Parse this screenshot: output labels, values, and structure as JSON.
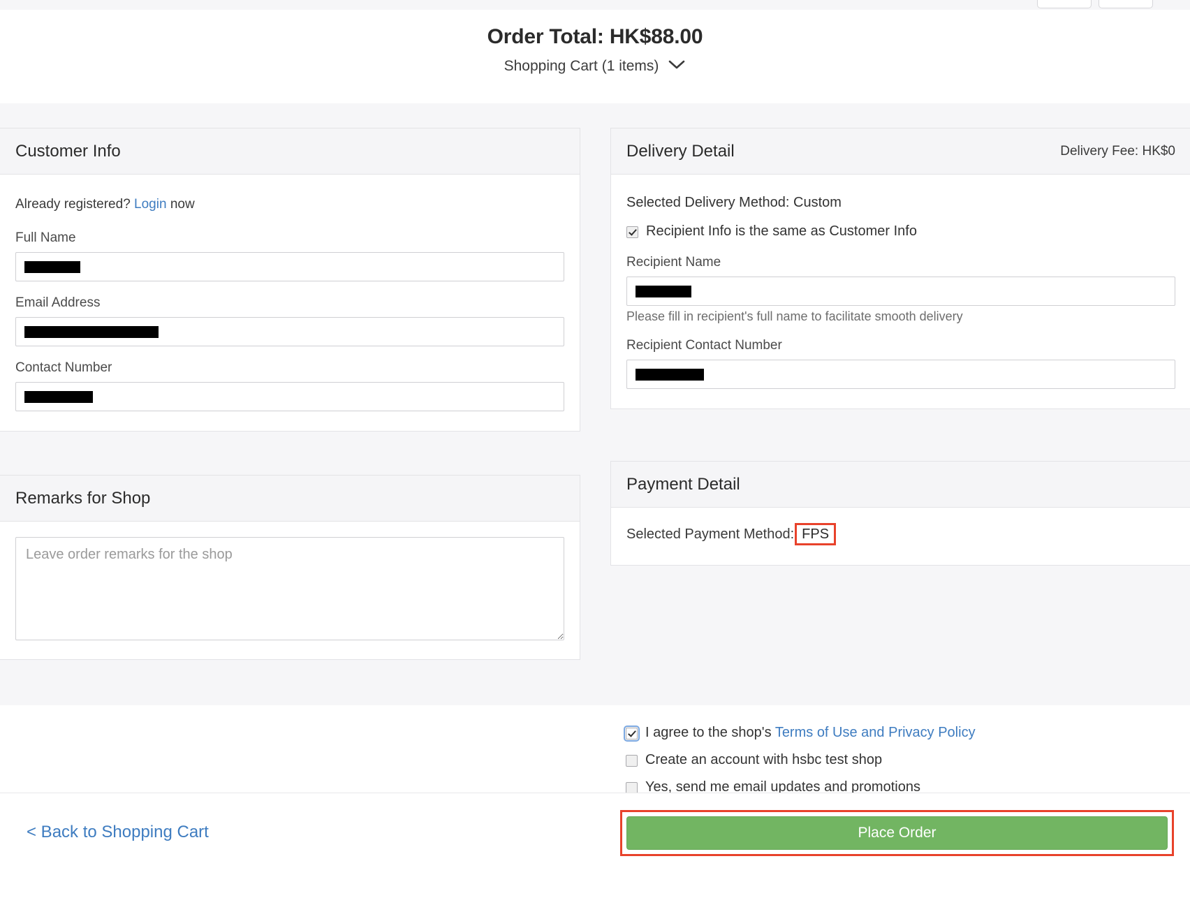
{
  "header": {
    "order_total": "Order Total: HK$88.00",
    "cart_summary": "Shopping Cart (1 items)",
    "chevron_icon": "chevron-down-icon"
  },
  "top_chrome": {
    "button_a_glyph": "▬",
    "button_b_glyph": "⌄⌄"
  },
  "customer_info": {
    "title": "Customer Info",
    "registered_prefix": "Already registered?",
    "login_label": "Login",
    "registered_suffix": "now",
    "fields": [
      {
        "label": "Full Name",
        "value": "",
        "redacted": true,
        "redact_width": 80
      },
      {
        "label": "Email Address",
        "value": "",
        "redacted": true,
        "redact_width": 192
      },
      {
        "label": "Contact Number",
        "value": "",
        "redacted": true,
        "redact_width": 98
      }
    ]
  },
  "remarks": {
    "title": "Remarks for Shop",
    "placeholder": "Leave order remarks for the shop",
    "value": ""
  },
  "delivery": {
    "title": "Delivery Detail",
    "fee_label": "Delivery Fee: HK$0",
    "method_line": "Selected Delivery Method: Custom",
    "same_as_customer_label": "Recipient Info is the same as Customer Info",
    "same_as_customer_checked": true,
    "recipient_name_label": "Recipient Name",
    "recipient_name_value": "",
    "recipient_name_hint": "Please fill in recipient's full name to facilitate smooth delivery",
    "recipient_contact_label": "Recipient Contact Number",
    "recipient_contact_value": ""
  },
  "payment": {
    "title": "Payment Detail",
    "method_prefix": "Selected Payment Method:",
    "method_value": "FPS",
    "method_highlighted": true
  },
  "agreements": [
    {
      "label_before": "I agree to the shop's",
      "link_label": "Terms of Use and Privacy Policy",
      "checked": true,
      "focused": true
    },
    {
      "label_before": "Create an account with hsbc test shop",
      "link_label": "",
      "checked": false,
      "focused": false
    },
    {
      "label_before": "Yes, send me email updates and promotions",
      "link_label": "",
      "checked": false,
      "focused": false
    }
  ],
  "footer": {
    "back_label": "< Back to Shopping Cart",
    "place_order_label": "Place Order",
    "place_order_highlighted": true
  },
  "colors": {
    "accent_link": "#3e7cc0",
    "primary_button": "#72b562",
    "annotation": "#e8422b",
    "page_background": "#f6f6f8",
    "panel_header": "#f5f5f7"
  }
}
